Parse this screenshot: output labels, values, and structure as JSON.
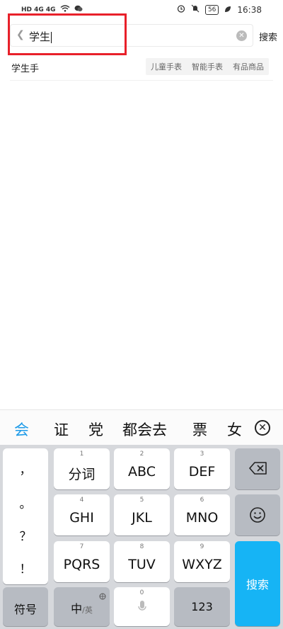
{
  "status_bar": {
    "left_text": "HD 4G 4G",
    "battery": "56",
    "time": "16:38"
  },
  "search": {
    "value": "学生",
    "button_label": "搜索"
  },
  "suggestion": {
    "text": "学生手",
    "tags": [
      "儿童手表",
      "智能手表",
      "有品商品"
    ]
  },
  "keyboard": {
    "candidates": [
      "会",
      "证",
      "党",
      "都会去",
      "票",
      "女"
    ],
    "punctuation": [
      "，",
      "。",
      "？",
      "！"
    ],
    "keys": {
      "k1": {
        "num": "1",
        "label": "分词"
      },
      "k2": {
        "num": "2",
        "label": "ABC"
      },
      "k3": {
        "num": "3",
        "label": "DEF"
      },
      "k4": {
        "num": "4",
        "label": "GHI"
      },
      "k5": {
        "num": "5",
        "label": "JKL"
      },
      "k6": {
        "num": "6",
        "label": "MNO"
      },
      "k7": {
        "num": "7",
        "label": "PQRS"
      },
      "k8": {
        "num": "8",
        "label": "TUV"
      },
      "k9": {
        "num": "9",
        "label": "WXYZ"
      },
      "k0": {
        "num": "0"
      }
    },
    "symbols_label": "符号",
    "lang_label_main": "中",
    "lang_label_sub": "/英",
    "num_label": "123",
    "search_label": "搜索"
  },
  "colors": {
    "accent": "#16b4f5",
    "highlight": "#e8202a",
    "candidate_active": "#1e9be8"
  }
}
